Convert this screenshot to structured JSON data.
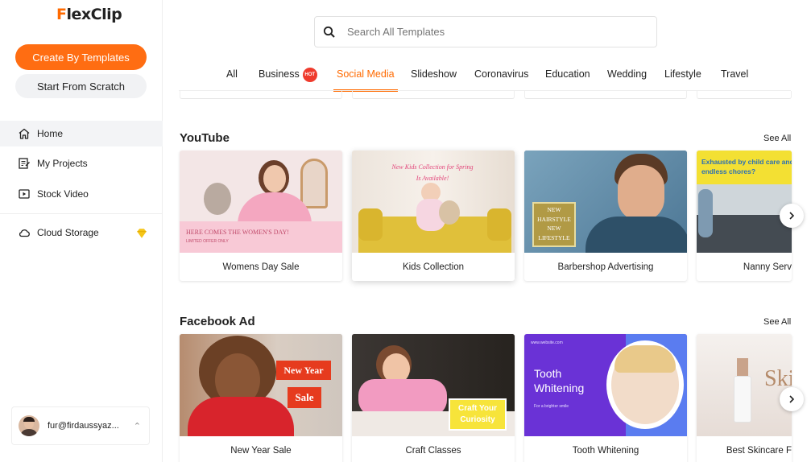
{
  "app": {
    "logo_first": "F",
    "logo_rest": "lexClip"
  },
  "sidebar": {
    "create_button": "Create By Templates",
    "scratch_button": "Start From Scratch",
    "nav": [
      {
        "label": "Home",
        "icon": "home-icon"
      },
      {
        "label": "My Projects",
        "icon": "projects-icon"
      },
      {
        "label": "Stock Video",
        "icon": "video-icon"
      },
      {
        "label": "Cloud Storage",
        "icon": "cloud-icon"
      }
    ],
    "user_email": "fur@firdaussyaz..."
  },
  "search": {
    "placeholder": "Search All Templates"
  },
  "tabs": [
    {
      "label": "All"
    },
    {
      "label": "Business",
      "badge": "HOT"
    },
    {
      "label": "Social Media",
      "active": true
    },
    {
      "label": "Slideshow"
    },
    {
      "label": "Coronavirus"
    },
    {
      "label": "Education"
    },
    {
      "label": "Wedding"
    },
    {
      "label": "Lifestyle"
    },
    {
      "label": "Travel"
    }
  ],
  "sections": {
    "youtube": {
      "title": "YouTube",
      "see_all": "See All",
      "cards": [
        {
          "label": "Womens Day Sale",
          "overlay": "HERE COMES THE WOMEN'S DAY!",
          "overlay2": "LIMITED OFFER ONLY"
        },
        {
          "label": "Kids Collection",
          "overlay": "New Kids Collection for Spring",
          "overlay2": "Is Available!"
        },
        {
          "label": "Barbershop Advertising",
          "overlay": "NEW HAIRSTYLE NEW LIFESTYLE"
        },
        {
          "label": "Nanny Serv",
          "overlay": "Exhausted by child care and endless chores?"
        }
      ]
    },
    "facebook": {
      "title": "Facebook Ad",
      "see_all": "See All",
      "cards": [
        {
          "label": "New Year Sale",
          "overlay": "New Year",
          "overlay2": "Sale"
        },
        {
          "label": "Craft Classes",
          "overlay": "Craft Your Curiosity"
        },
        {
          "label": "Tooth Whitening",
          "overlay": "Tooth Whitening",
          "overlay2": "For a brighter smile",
          "site": "www.website.com"
        },
        {
          "label": "Best Skincare F",
          "overlay": "Ski"
        }
      ]
    }
  },
  "colors": {
    "accent": "#ff6d12",
    "hot": "#ef3b2d",
    "premium": "#f5c518"
  }
}
